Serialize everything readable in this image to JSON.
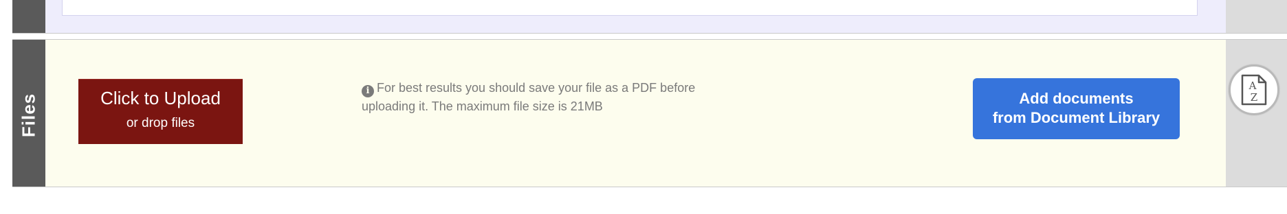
{
  "files_section": {
    "tab_label": "Files",
    "upload": {
      "main_label": "Click to Upload",
      "sub_label": "or drop files"
    },
    "hint_text": "For best results you should save your file as a PDF before uploading it. The maximum file size is 21MB",
    "library_button": {
      "line1": "Add documents",
      "line2": "from Document Library"
    },
    "sort_icon_letters": {
      "top": "A",
      "bottom": "Z"
    }
  },
  "icons": {
    "info": "info-icon",
    "sort": "sort-az-document-icon"
  },
  "colors": {
    "upload_button": "#7b1511",
    "library_button": "#3674dc",
    "files_panel_bg": "#fdfdee",
    "top_panel_bg": "#eeedfc",
    "side_tab": "#5a5a5a"
  }
}
